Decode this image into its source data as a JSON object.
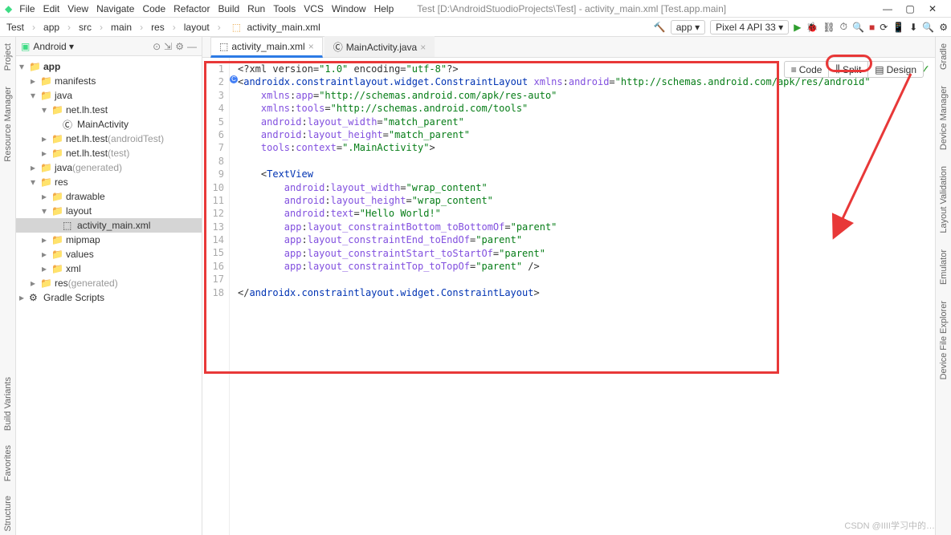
{
  "window": {
    "title": "Test [D:\\AndroidStuodioProjects\\Test] - activity_main.xml [Test.app.main]",
    "min_icon": "—",
    "max_icon": "▢",
    "close_icon": "✕"
  },
  "menu": [
    "File",
    "Edit",
    "View",
    "Navigate",
    "Code",
    "Refactor",
    "Build",
    "Run",
    "Tools",
    "VCS",
    "Window",
    "Help"
  ],
  "breadcrumb": [
    "Test",
    "app",
    "src",
    "main",
    "res",
    "layout",
    "activity_main.xml"
  ],
  "toolbar": {
    "run_config": "app ▾",
    "device": "Pixel 4 API 33 ▾"
  },
  "left_rail": [
    "Project",
    "Resource Manager"
  ],
  "right_rail": [
    "Gradle",
    "Device Manager",
    "Layout Validation",
    "Emulator",
    "Device File Explorer"
  ],
  "bottom_rail": [
    "Build Variants",
    "Favorites",
    "Structure"
  ],
  "project": {
    "selector": "Android ▾",
    "tree": [
      {
        "indent": 0,
        "arrow": "▾",
        "icon": "📁",
        "label": "app",
        "bold": true
      },
      {
        "indent": 1,
        "arrow": "▸",
        "icon": "📁",
        "label": "manifests"
      },
      {
        "indent": 1,
        "arrow": "▾",
        "icon": "📁",
        "label": "java"
      },
      {
        "indent": 2,
        "arrow": "▾",
        "icon": "📁",
        "label": "net.lh.test"
      },
      {
        "indent": 3,
        "arrow": "",
        "icon": "Ⓒ",
        "label": "MainActivity"
      },
      {
        "indent": 2,
        "arrow": "▸",
        "icon": "📁",
        "label": "net.lh.test",
        "gray": " (androidTest)"
      },
      {
        "indent": 2,
        "arrow": "▸",
        "icon": "📁",
        "label": "net.lh.test",
        "gray": " (test)"
      },
      {
        "indent": 1,
        "arrow": "▸",
        "icon": "📁",
        "label": "java",
        "gray": " (generated)"
      },
      {
        "indent": 1,
        "arrow": "▾",
        "icon": "📁",
        "label": "res"
      },
      {
        "indent": 2,
        "arrow": "▸",
        "icon": "📁",
        "label": "drawable"
      },
      {
        "indent": 2,
        "arrow": "▾",
        "icon": "📁",
        "label": "layout"
      },
      {
        "indent": 3,
        "arrow": "",
        "icon": "⬚",
        "label": "activity_main.xml",
        "selected": true
      },
      {
        "indent": 2,
        "arrow": "▸",
        "icon": "📁",
        "label": "mipmap"
      },
      {
        "indent": 2,
        "arrow": "▸",
        "icon": "📁",
        "label": "values"
      },
      {
        "indent": 2,
        "arrow": "▸",
        "icon": "📁",
        "label": "xml"
      },
      {
        "indent": 1,
        "arrow": "▸",
        "icon": "📁",
        "label": "res",
        "gray": " (generated)"
      },
      {
        "indent": 0,
        "arrow": "▸",
        "icon": "⚙",
        "label": "Gradle Scripts"
      }
    ]
  },
  "tabs": [
    {
      "icon": "⬚",
      "label": "activity_main.xml",
      "active": true
    },
    {
      "icon": "Ⓒ",
      "label": "MainActivity.java",
      "active": false
    }
  ],
  "view_switcher": [
    {
      "icon": "≡",
      "label": "Code"
    },
    {
      "icon": "⫼",
      "label": "Split"
    },
    {
      "icon": "▤",
      "label": "Design"
    }
  ],
  "code": {
    "line_count": 18,
    "lines": [
      {
        "raw": "<?xml version=\"1.0\" encoding=\"utf-8\"?>",
        "indent": 0
      },
      {
        "raw": "<androidx.constraintlayout.widget.ConstraintLayout xmlns:android=\"http://schemas.android.com/apk/res/android\"",
        "indent": 0
      },
      {
        "raw": "    xmlns:app=\"http://schemas.android.com/apk/res-auto\"",
        "indent": 0
      },
      {
        "raw": "    xmlns:tools=\"http://schemas.android.com/tools\"",
        "indent": 0
      },
      {
        "raw": "    android:layout_width=\"match_parent\"",
        "indent": 0
      },
      {
        "raw": "    android:layout_height=\"match_parent\"",
        "indent": 0
      },
      {
        "raw": "    tools:context=\".MainActivity\">",
        "indent": 0
      },
      {
        "raw": "",
        "indent": 0
      },
      {
        "raw": "    <TextView",
        "indent": 0
      },
      {
        "raw": "        android:layout_width=\"wrap_content\"",
        "indent": 0
      },
      {
        "raw": "        android:layout_height=\"wrap_content\"",
        "indent": 0
      },
      {
        "raw": "        android:text=\"Hello World!\"",
        "indent": 0
      },
      {
        "raw": "        app:layout_constraintBottom_toBottomOf=\"parent\"",
        "indent": 0
      },
      {
        "raw": "        app:layout_constraintEnd_toEndOf=\"parent\"",
        "indent": 0
      },
      {
        "raw": "        app:layout_constraintStart_toStartOf=\"parent\"",
        "indent": 0
      },
      {
        "raw": "        app:layout_constraintTop_toTopOf=\"parent\" />",
        "indent": 0
      },
      {
        "raw": "",
        "indent": 0
      },
      {
        "raw": "</androidx.constraintlayout.widget.ConstraintLayout>",
        "indent": 0
      }
    ]
  },
  "watermark": "CSDN @IIII学习中的…"
}
